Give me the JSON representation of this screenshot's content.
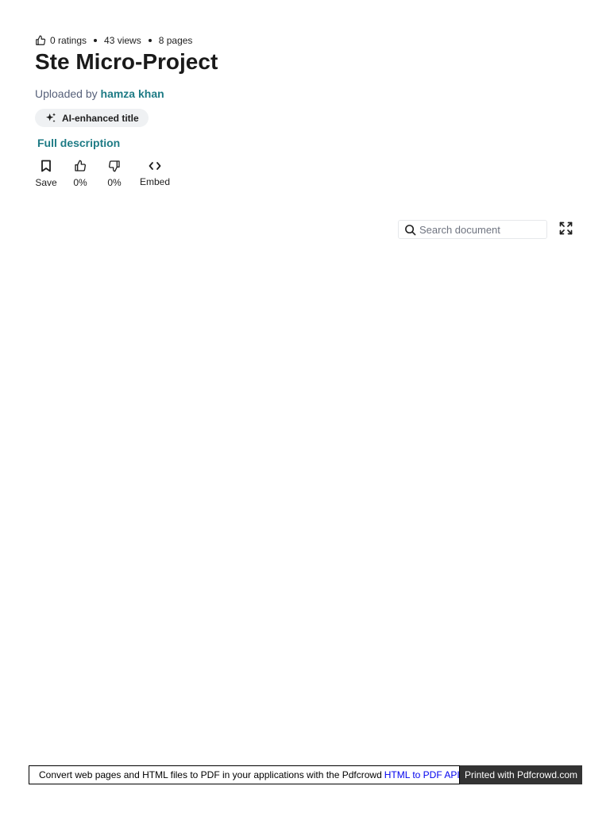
{
  "meta": {
    "ratings": "0 ratings",
    "views": "43 views",
    "pages": "8 pages",
    "icon": "thumbs-up-icon"
  },
  "title": "Ste Micro-Project",
  "uploader": {
    "prefix": "Uploaded by",
    "name": "hamza khan"
  },
  "badge": {
    "label": "AI-enhanced title",
    "icon": "sparkle-icon"
  },
  "full_description_link": "Full description",
  "actions": [
    {
      "label": "Save",
      "icon": "bookmark-icon"
    },
    {
      "label": "0%",
      "icon": "thumbs-up-icon"
    },
    {
      "label": "0%",
      "icon": "thumbs-down-icon"
    },
    {
      "label": "Embed",
      "icon": "code-icon"
    }
  ],
  "search": {
    "placeholder": "Search document",
    "value": "",
    "icon": "search-icon"
  },
  "fullscreen": {
    "icon": "expand-icon"
  },
  "pdf_banner": {
    "text": "Convert web pages and HTML files to PDF in your applications with the Pdfcrowd",
    "link": "HTML to PDF API",
    "printed": "Printed with Pdfcrowd.com"
  },
  "colors": {
    "accent": "#1e7b85",
    "text": "#1e1e1e",
    "muted": "#57617a",
    "badge_bg": "#eff1f3",
    "banner_dark": "#333333",
    "link_blue": "#0000ee"
  }
}
